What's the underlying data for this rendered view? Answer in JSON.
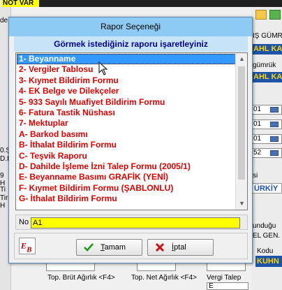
{
  "background": {
    "top_label": "NOT VAR",
    "left_fragments": [
      "de",
      "",
      "0.Ş",
      "D.I",
      "",
      "9 H",
      "Ti",
      "Tir-H"
    ],
    "right_fragments": {
      "label1": "IŞ GÜMR",
      "badge1": "AHL KAY",
      "label2": "gümrük",
      "badge2": "AHL KAY",
      "combo_values": [
        "01",
        "01",
        "01",
        "52"
      ],
      "label3": "si",
      "badge3": "ÜRKİY",
      "label4": "unduğu",
      "label5": "EL GEN.",
      "label6": "Kodu",
      "badge_kuhn": "KUHN"
    },
    "bottom": {
      "field1_label": "Top. Brüt Ağırlık <F4>",
      "field2_label": "Top. Net Ağırlık <F4>",
      "field3_label": "Vergi Talep",
      "field3_value": "E"
    }
  },
  "dialog": {
    "title": "Rapor Seçeneği",
    "header": "Görmek istediğiniz raporu işaretleyiniz",
    "items": [
      "1- Beyanname",
      "2- Vergiler Tablosu",
      "3- Kıymet Bildirim Formu",
      "4- EK Belge ve Dilekçeler",
      "5- 933 Sayılı Muafiyet Bildirim Formu",
      "6- Fatura Tastik Nüshası",
      "7- Mektuplar",
      "A- Barkod basımı",
      "B- İthalat Bildirim Formu",
      "C- Teşvik Raporu",
      "D- Dahilde İşleme İzni Talep Formu (2005/1)",
      "E- Beyanname Basımı GRAFİK (YENİ)",
      "F- Kıymet Bildirim Formu (ŞABLONLU)",
      "G- İthalat Bildirim Formu"
    ],
    "selected_index": 0,
    "no_label": "No",
    "no_value": "A1",
    "ok_label": "Tamam",
    "cancel_label": "İptal",
    "colors": {
      "title_bg": "#8ecbf4",
      "header_bg": "#c6e3f7",
      "header_text": "#00008c",
      "item_text": "#e00000",
      "selection_bg": "#3399ff",
      "input_bg": "#ffff00"
    },
    "icons": [
      "ok-checkmark-icon",
      "cancel-x-icon",
      "company-logo-icon",
      "mouse-cursor-icon",
      "scroll-up-arrow-icon",
      "scroll-down-arrow-icon"
    ]
  }
}
